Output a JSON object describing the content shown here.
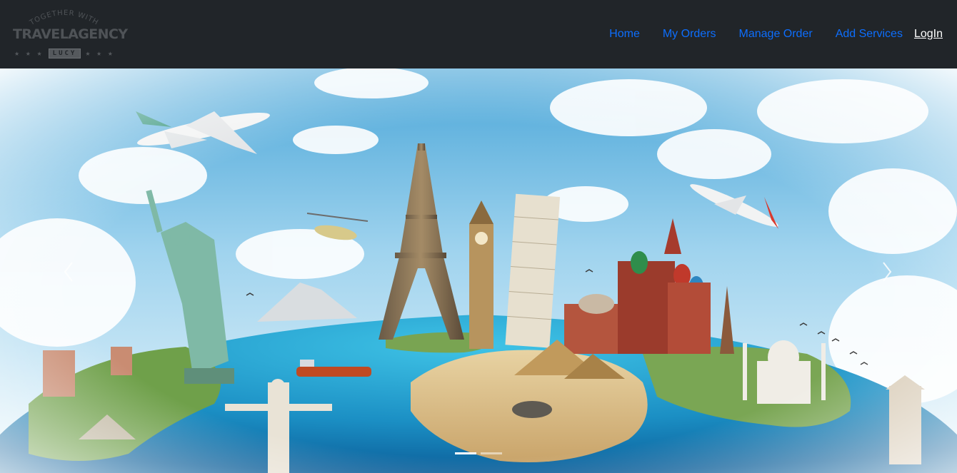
{
  "brand": {
    "arc_text": "TOGETHER WITH",
    "name": "TRAVELAGENCY",
    "badge": "LUCY",
    "stars_left": "★ ★ ★",
    "stars_right": "★ ★ ★"
  },
  "nav": {
    "links": [
      {
        "label": "Home"
      },
      {
        "label": "My Orders"
      },
      {
        "label": "Manage Order"
      },
      {
        "label": "Add Services"
      }
    ],
    "login_label": "LogIn"
  },
  "carousel": {
    "slide_count": 2,
    "active_index": 0,
    "prev_icon": "chevron-left-icon",
    "next_icon": "chevron-right-icon"
  },
  "colors": {
    "navbar_bg": "#212529",
    "link": "#0d6efd",
    "login": "#ffffff"
  }
}
